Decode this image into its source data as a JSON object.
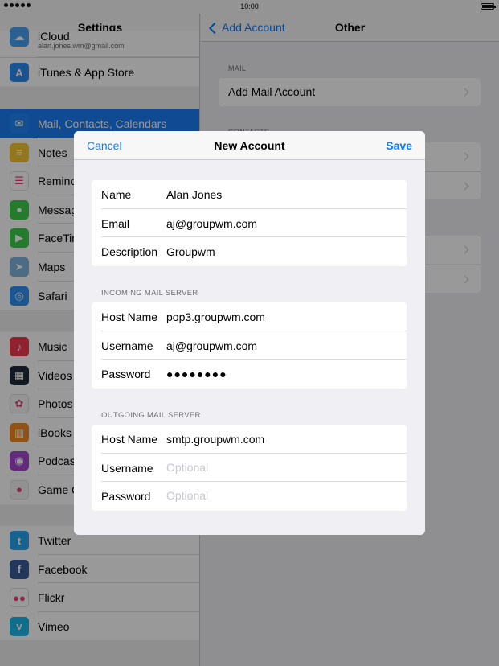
{
  "status_bar": {
    "time": "10:00"
  },
  "master": {
    "title": "Settings",
    "icloud": {
      "label": "iCloud",
      "sub": "alan.jones.wm@gmail.com"
    },
    "group1": [
      {
        "label": "iTunes & App Store",
        "icon": "app-store-icon",
        "color": "#2a8bf2",
        "glyph": "A"
      }
    ],
    "group2": [
      {
        "label": "Mail, Contacts, Calendars",
        "icon": "mail-icon",
        "color": "#1f86f5",
        "glyph": "✉",
        "selected": true
      },
      {
        "label": "Notes",
        "icon": "notes-icon",
        "color": "#f6c633",
        "glyph": "≡"
      },
      {
        "label": "Reminders",
        "icon": "reminders-icon",
        "color": "#ffffff",
        "glyph": "☰"
      },
      {
        "label": "Messages",
        "icon": "messages-icon",
        "color": "#3fce4b",
        "glyph": "●"
      },
      {
        "label": "FaceTime",
        "icon": "facetime-icon",
        "color": "#3fce4b",
        "glyph": "▶"
      },
      {
        "label": "Maps",
        "icon": "maps-icon",
        "color": "#7fb4e0",
        "glyph": "➤"
      },
      {
        "label": "Safari",
        "icon": "safari-icon",
        "color": "#2d8ff0",
        "glyph": "◎"
      }
    ],
    "group3": [
      {
        "label": "Music",
        "icon": "music-icon",
        "color": "#f0374f",
        "glyph": "♪"
      },
      {
        "label": "Videos",
        "icon": "videos-icon",
        "color": "#1e2a3a",
        "glyph": "▦"
      },
      {
        "label": "Photos",
        "icon": "photos-icon",
        "color": "#f7f7f7",
        "glyph": "✿"
      },
      {
        "label": "iBooks",
        "icon": "ibooks-icon",
        "color": "#f08a24",
        "glyph": "▥"
      },
      {
        "label": "Podcasts",
        "icon": "podcasts-icon",
        "color": "#a246cf",
        "glyph": "◉"
      },
      {
        "label": "Game Center",
        "icon": "game-center-icon",
        "color": "#f2f2f2",
        "glyph": "●"
      }
    ],
    "group4": [
      {
        "label": "Twitter",
        "icon": "twitter-icon",
        "color": "#2aa3ef",
        "glyph": "t"
      },
      {
        "label": "Facebook",
        "icon": "facebook-icon",
        "color": "#3b5b98",
        "glyph": "f"
      },
      {
        "label": "Flickr",
        "icon": "flickr-icon",
        "color": "#ffffff",
        "glyph": "●●"
      },
      {
        "label": "Vimeo",
        "icon": "vimeo-icon",
        "color": "#1ab7ea",
        "glyph": "v"
      }
    ]
  },
  "detail": {
    "back_label": "Add Account",
    "title": "Other",
    "mail_section": "MAIL",
    "add_mail_account": "Add Mail Account",
    "contacts_section": "CONTACTS"
  },
  "modal": {
    "cancel": "Cancel",
    "title": "New Account",
    "save": "Save",
    "account": {
      "name_label": "Name",
      "name_value": "Alan Jones",
      "email_label": "Email",
      "email_value": "aj@groupwm.com",
      "description_label": "Description",
      "description_value": "Groupwm"
    },
    "incoming": {
      "section": "INCOMING MAIL SERVER",
      "host_label": "Host Name",
      "host_value": "pop3.groupwm.com",
      "username_label": "Username",
      "username_value": "aj@groupwm.com",
      "password_label": "Password",
      "password_value": "●●●●●●●●"
    },
    "outgoing": {
      "section": "OUTGOING MAIL SERVER",
      "host_label": "Host Name",
      "host_value": "smtp.groupwm.com",
      "username_label": "Username",
      "username_placeholder": "Optional",
      "password_label": "Password",
      "password_placeholder": "Optional"
    }
  }
}
